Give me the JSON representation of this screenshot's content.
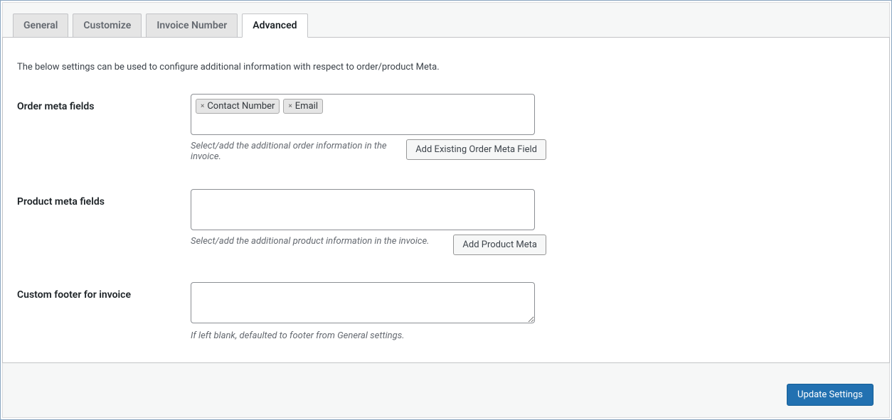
{
  "tabs": {
    "general": "General",
    "customize": "Customize",
    "invoice_number": "Invoice Number",
    "advanced": "Advanced"
  },
  "intro": "The below settings can be used to configure additional information with respect to order/product Meta.",
  "order_meta": {
    "label": "Order meta fields",
    "tags": [
      "Contact Number",
      "Email"
    ],
    "help": "Select/add the additional order information in the invoice.",
    "button": "Add Existing Order Meta Field"
  },
  "product_meta": {
    "label": "Product meta fields",
    "help": "Select/add the additional product information in the invoice.",
    "button": "Add Product Meta"
  },
  "custom_footer": {
    "label": "Custom footer for invoice",
    "help": "If left blank, defaulted to footer from General settings."
  },
  "submit": "Update Settings"
}
